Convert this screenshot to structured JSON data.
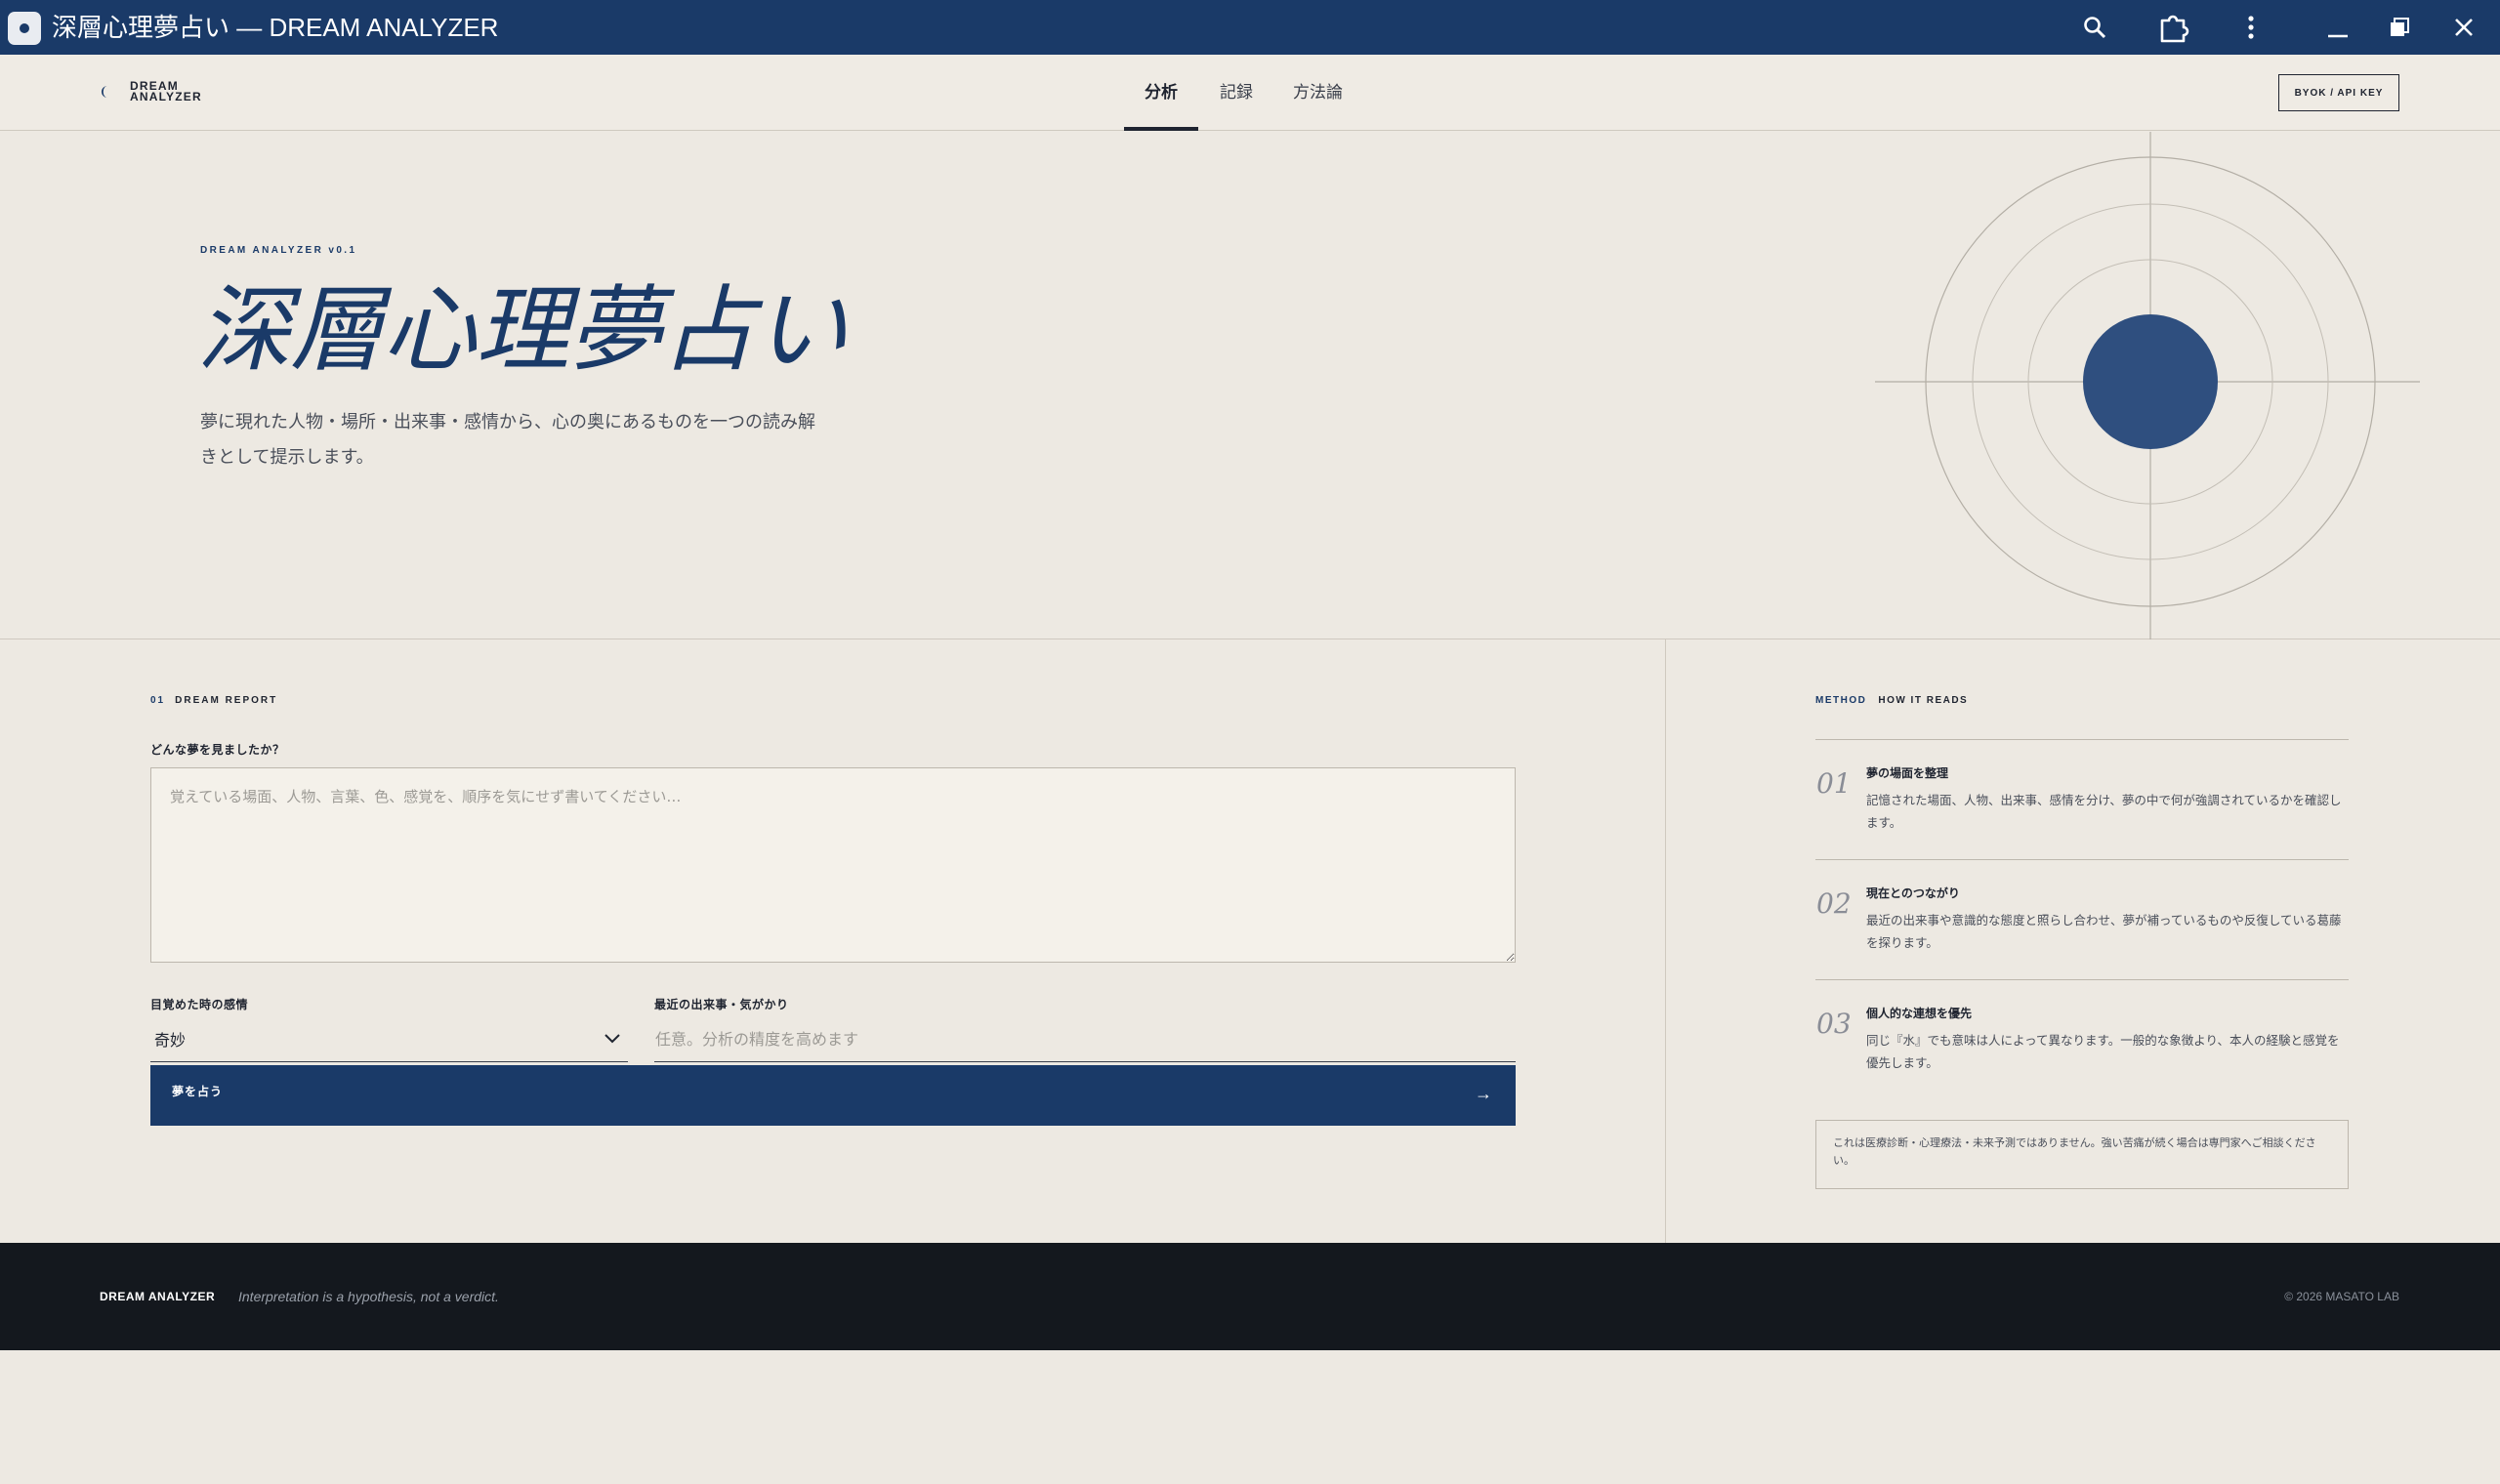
{
  "window": {
    "title": "深層心理夢占い — DREAM ANALYZER"
  },
  "titlebar_icons": [
    "search-icon",
    "extension-icon",
    "more-icon",
    "minimize-icon",
    "restore-icon",
    "close-icon"
  ],
  "nav": {
    "logo_line1": "DREAM",
    "logo_line2": "ANALYZER",
    "tabs": [
      {
        "label": "分析",
        "active": true
      },
      {
        "label": "記録",
        "active": false
      },
      {
        "label": "方法論",
        "active": false
      }
    ],
    "byok_label": "BYOK / API KEY"
  },
  "hero": {
    "kicker": "DREAM ANALYZER v0.1",
    "title": "深層心理夢占い",
    "description": "夢に現れた人物・場所・出来事・感情から、心の奥にあるものを一つの読み解きとして提示します。"
  },
  "form": {
    "section_num": "01",
    "section_title": "DREAM REPORT",
    "dream_label": "どんな夢を見ましたか？",
    "dream_placeholder": "覚えている場面、人物、言葉、色、感覚を、順序を気にせず書いてください…",
    "emotion_label": "目覚めた時の感情",
    "emotion_value": "奇妙",
    "recent_label": "最近の出来事・気がかり",
    "recent_placeholder": "任意。分析の精度を高めます",
    "submit_label": "夢を占う",
    "submit_arrow": "→"
  },
  "method": {
    "kicker": "METHOD",
    "title": "HOW IT READS",
    "steps": [
      {
        "num": "01",
        "title": "夢の場面を整理",
        "body": "記憶された場面、人物、出来事、感情を分け、夢の中で何が強調されているかを確認します。"
      },
      {
        "num": "02",
        "title": "現在とのつながり",
        "body": "最近の出来事や意識的な態度と照らし合わせ、夢が補っているものや反復している葛藤を探ります。"
      },
      {
        "num": "03",
        "title": "個人的な連想を優先",
        "body": "同じ『水』でも意味は人によって異なります。一般的な象徴より、本人の経験と感覚を優先します。"
      }
    ],
    "disclaimer": "これは医療診断・心理療法・未来予測ではありません。強い苦痛が続く場合は専門家へご相談ください。"
  },
  "footer": {
    "brand": "DREAM ANALYZER",
    "tagline": "Interpretation is a hypothesis, not a verdict.",
    "copyright": "© 2026 MASATO LAB"
  },
  "colors": {
    "accent": "#1a3a68",
    "background": "#ede9e2",
    "footer": "#14181e"
  }
}
